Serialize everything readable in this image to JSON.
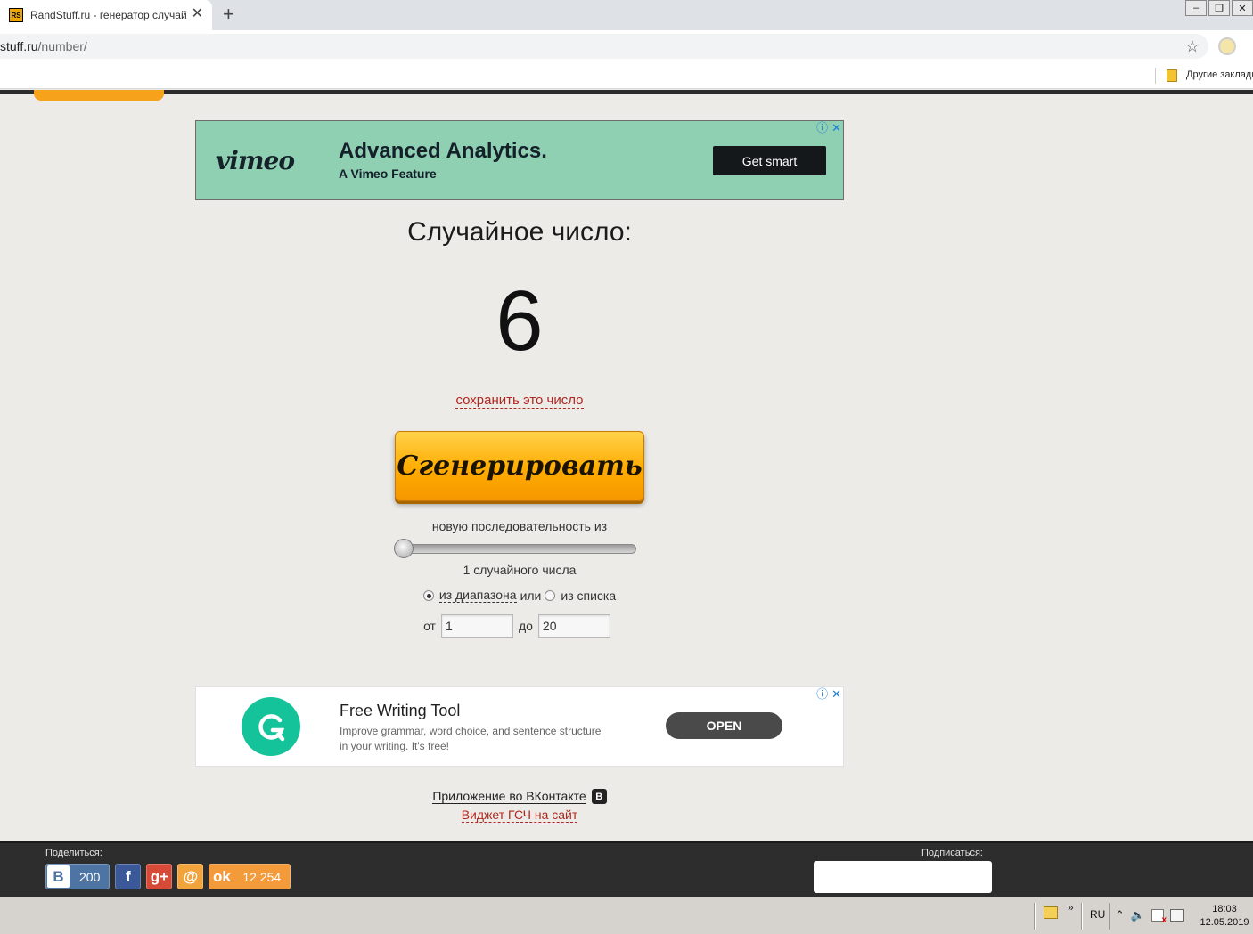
{
  "browser": {
    "tab_title": "RandStuff.ru - генератор случайны",
    "favicon_text": "RS",
    "new_tab_symbol": "+",
    "close_symbol": "✕",
    "url_host": "stuff.ru",
    "url_path": "/number/",
    "bookmark_folder_label": "Другие заклади",
    "window_buttons": [
      "‒",
      "❐",
      "✕"
    ]
  },
  "ad_top": {
    "brand": "vimeo",
    "title": "Advanced Analytics.",
    "subtitle": "A Vimeo Feature",
    "cta": "Get smart",
    "bg_color": "#8fcfb2"
  },
  "generator": {
    "title": "Случайное число:",
    "result": "6",
    "save_link": "сохранить это число",
    "button_label": "Сгенерировать",
    "sequence_label": "новую последовательность из",
    "count_label": "1 случайного числа",
    "slider_value": 1,
    "mode_range_label": "из диапазона",
    "mode_or": "или",
    "mode_list_label": "из списка",
    "mode_selected": "range",
    "from_label": "от",
    "from_value": "1",
    "to_label": "до",
    "to_value": "20"
  },
  "ad_bottom": {
    "title": "Free Writing Tool",
    "body": "Improve grammar, word choice, and sentence structure in your writing. It's free!",
    "cta": "OPEN",
    "logo_color": "#15c39a"
  },
  "links": {
    "vk_app": "Приложение во ВКонтакте",
    "vk_badge": "В",
    "widget": "Виджет ГСЧ на сайт"
  },
  "footer": {
    "share_label": "Поделиться:",
    "vk_letter": "B",
    "vk_count": "200",
    "fb_letter": "f",
    "gp_letter": "g+",
    "mail_letter": "@",
    "ok_letter": "ok",
    "ok_count": "12 254",
    "subscribe_label": "Подписаться:"
  },
  "taskbar": {
    "chevron": "»",
    "lang": "RU",
    "time": "18:03",
    "date": "12.05.2019"
  },
  "colors": {
    "accent_orange": "#ffab00",
    "link_red": "#b0271f",
    "footer_dark": "#2d2d2d"
  }
}
